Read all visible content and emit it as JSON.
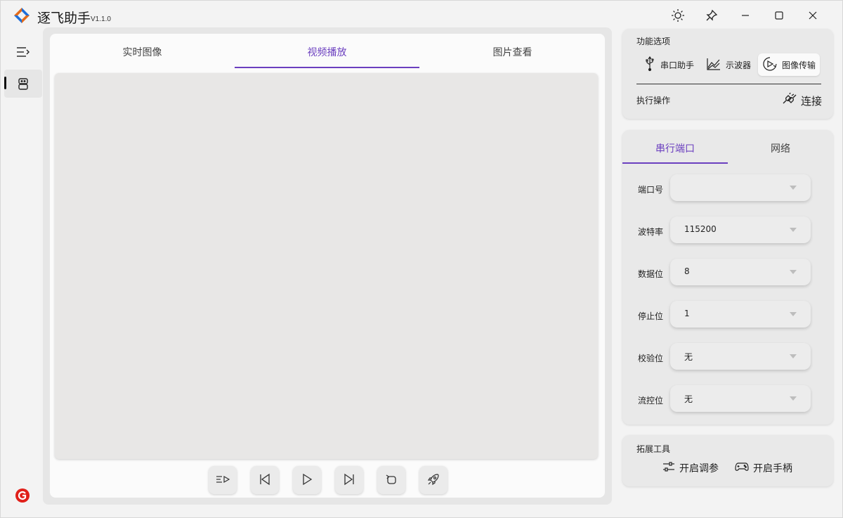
{
  "app": {
    "title": "逐飞助手",
    "version": "V1.1.0"
  },
  "window_controls": {
    "theme_icon": "sun-icon",
    "pin_icon": "pin-icon",
    "minimize_icon": "minimize-icon",
    "maximize_icon": "maximize-icon",
    "close_icon": "close-icon"
  },
  "main": {
    "tabs": [
      {
        "label": "实时图像",
        "active": false
      },
      {
        "label": "视频播放",
        "active": true
      },
      {
        "label": "图片查看",
        "active": false
      }
    ],
    "controls": [
      "playlist-icon",
      "previous-icon",
      "play-icon",
      "next-icon",
      "loop-icon",
      "rocket-icon"
    ]
  },
  "function_options": {
    "title": "功能选项",
    "buttons": [
      {
        "label": "串口助手",
        "icon": "usb-icon",
        "selected": false
      },
      {
        "label": "示波器",
        "icon": "chart-icon",
        "selected": false
      },
      {
        "label": "图像传输",
        "icon": "image-transfer-icon",
        "selected": true
      }
    ],
    "action_title": "执行操作",
    "connect_label": "连接"
  },
  "port_settings": {
    "tabs": [
      {
        "label": "串行端口",
        "active": true
      },
      {
        "label": "网络",
        "active": false
      }
    ],
    "fields": [
      {
        "label": "端口号",
        "value": ""
      },
      {
        "label": "波特率",
        "value": "115200"
      },
      {
        "label": "数据位",
        "value": "8"
      },
      {
        "label": "停止位",
        "value": "1"
      },
      {
        "label": "校验位",
        "value": "无"
      },
      {
        "label": "流控位",
        "value": "无"
      }
    ]
  },
  "extension_tools": {
    "title": "拓展工具",
    "tune_label": "开启调参",
    "gamepad_label": "开启手柄"
  },
  "colors": {
    "accent": "#6b3fbf"
  }
}
